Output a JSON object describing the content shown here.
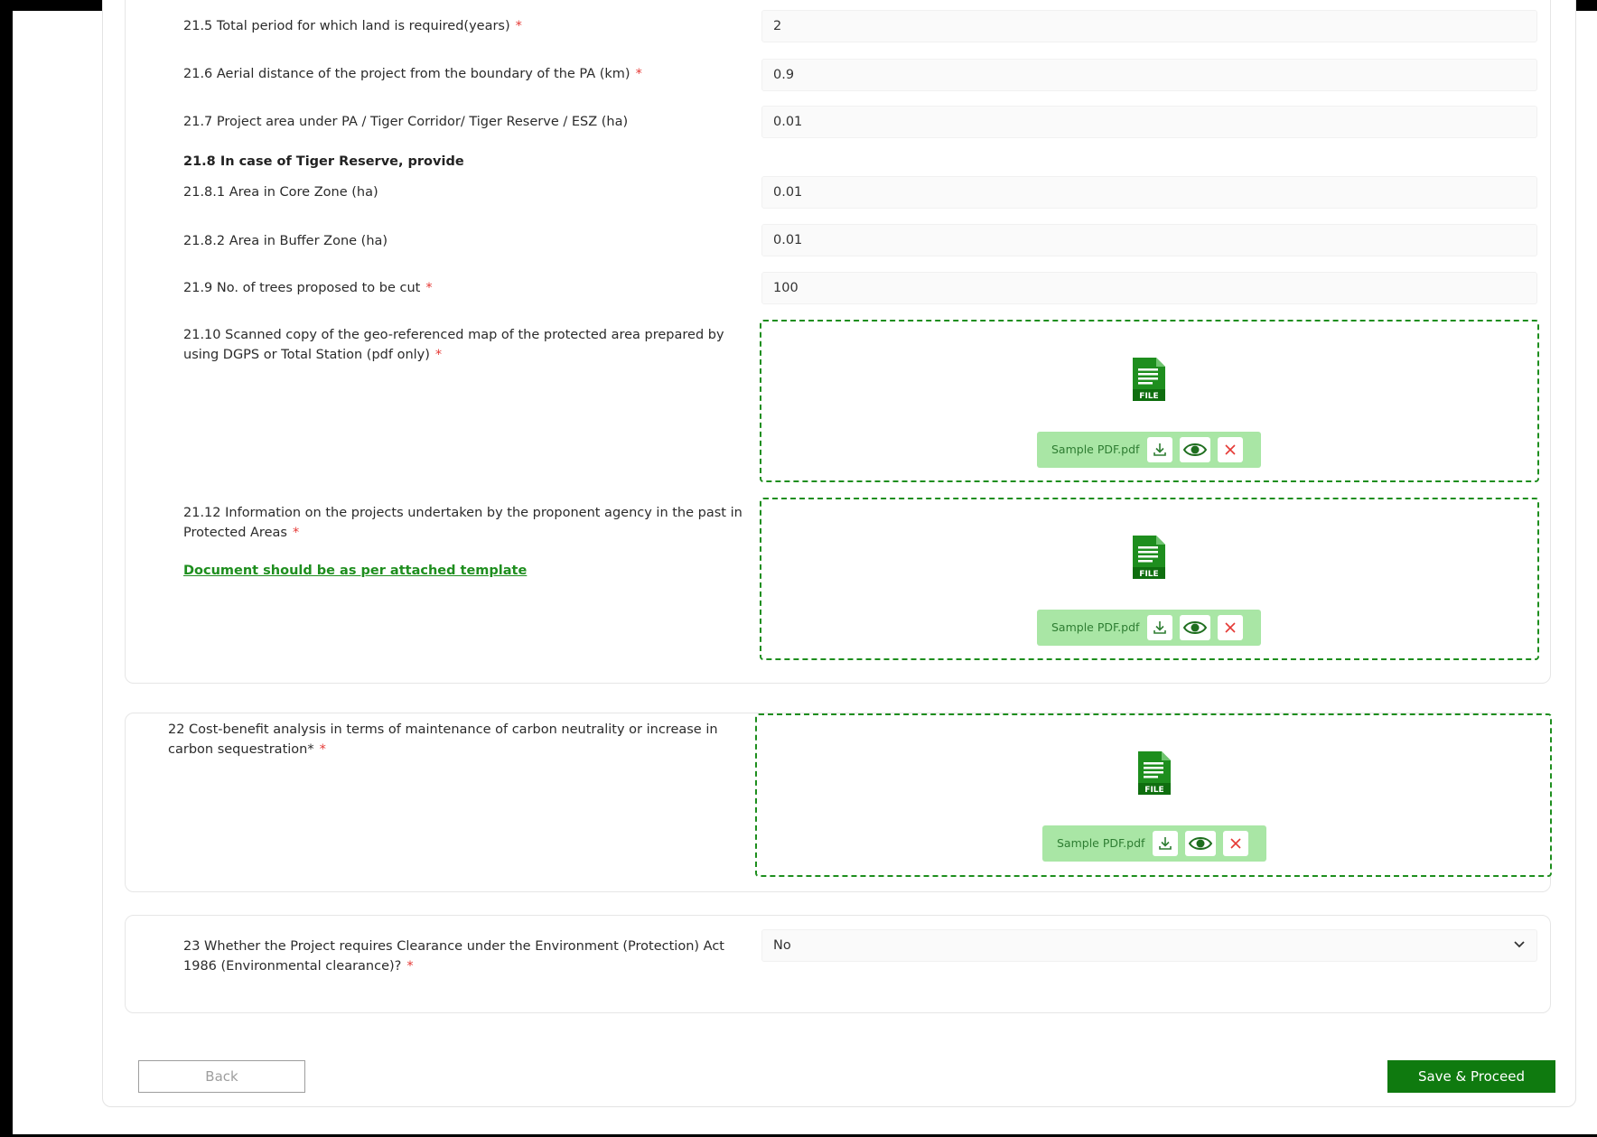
{
  "form": {
    "q21_5": {
      "label": "21.5 Total period for which land is required(years)",
      "required": "*",
      "value": "2"
    },
    "q21_6": {
      "label": "21.6 Aerial distance of the project from the boundary of the PA (km)",
      "required": "*",
      "value": "0.9"
    },
    "q21_7": {
      "label": "21.7 Project area under PA / Tiger Corridor/ Tiger Reserve / ESZ (ha)",
      "value": "0.01"
    },
    "q21_8": {
      "label": "21.8 In case of Tiger Reserve, provide"
    },
    "q21_8_1": {
      "label": "21.8.1 Area in Core Zone (ha)",
      "value": "0.01"
    },
    "q21_8_2": {
      "label": "21.8.2 Area in Buffer Zone (ha)",
      "value": "0.01"
    },
    "q21_9": {
      "label": "21.9 No. of trees proposed to be cut",
      "required": "*",
      "value": "100"
    },
    "q21_10": {
      "label_line1": "21.10 Scanned copy of the geo-referenced map of the protected area prepared by",
      "label_line2": "using DGPS or Total Station (pdf only)",
      "required": "*",
      "file_icon_text": "FILE",
      "file_name": "Sample PDF.pdf"
    },
    "q21_12": {
      "label_line1": "21.12 Information on the projects undertaken by the proponent agency in the past in",
      "label_line2": "Protected Areas",
      "required": "*",
      "template_link": "Document should be as per attached template",
      "file_icon_text": "FILE",
      "file_name": "Sample PDF.pdf"
    },
    "q22": {
      "label_line1": "22 Cost-benefit analysis in terms of maintenance of carbon neutrality or increase in",
      "label_line2": "carbon sequestration*",
      "required": "*",
      "file_icon_text": "FILE",
      "file_name": "Sample PDF.pdf"
    },
    "q23": {
      "label_line1": "23 Whether the Project requires Clearance under the Environment (Protection) Act",
      "label_line2": "1986 (Environmental clearance)?",
      "required": "*",
      "selected": "No"
    }
  },
  "actions": {
    "back_label": "Back",
    "save_label": "Save & Proceed"
  },
  "colors": {
    "accent": "#0f7a0f",
    "dashed_border": "#1e8e1e",
    "chip_bg": "#a9e6a5",
    "required": "#e53935"
  },
  "icons": {
    "file": "file-pdf-icon",
    "download": "download-icon",
    "view": "eye-icon",
    "remove": "close-icon",
    "dropdown": "chevron-down-icon"
  }
}
